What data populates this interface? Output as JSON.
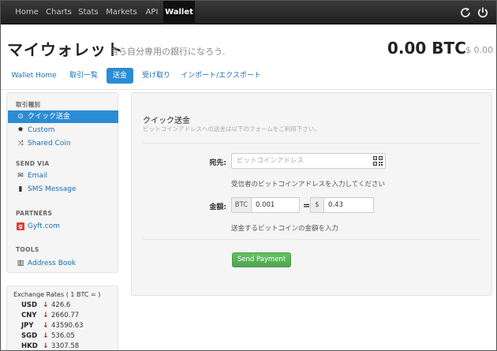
{
  "nav": {
    "items": [
      "Home",
      "Charts",
      "Stats",
      "Markets",
      "API",
      "Wallet"
    ],
    "active": "Wallet",
    "icons": [
      "refresh-icon",
      "power-icon"
    ]
  },
  "header": {
    "title": "マイウォレット",
    "subtitle": "自ら自分専用の銀行になろう.",
    "balance_btc": "0.00 BTC",
    "balance_usd": "$ 0.00"
  },
  "tabs": [
    "Wallet Home",
    "取引一覧",
    "送金",
    "受け取り",
    "インポート/エクスポート"
  ],
  "sidebar": {
    "section_types": "取引種別",
    "types": [
      {
        "icon": "target-icon",
        "label": "クイック送金",
        "active": true
      },
      {
        "icon": "gear-icon",
        "label": "Custom"
      },
      {
        "icon": "shuffle-icon",
        "label": "Shared Coin"
      }
    ],
    "section_send": "SEND VIA",
    "send": [
      {
        "icon": "envelope-icon",
        "label": "Email"
      },
      {
        "icon": "phone-icon",
        "label": "SMS Message"
      }
    ],
    "section_partners": "PARTNERS",
    "partners": [
      {
        "icon": "gyft-icon",
        "icon_text": "g",
        "label": "Gyft.com"
      }
    ],
    "section_tools": "TOOLS",
    "tools": [
      {
        "icon": "book-icon",
        "label": "Address Book"
      }
    ]
  },
  "rates": {
    "title": "Exchange Rates ( 1 BTC = )",
    "down_color": "#b3231a",
    "rows": [
      {
        "code": "USD",
        "value": "426.6"
      },
      {
        "code": "CNY",
        "value": "2660.77"
      },
      {
        "code": "JPY",
        "value": "43590.63"
      },
      {
        "code": "SGD",
        "value": "536.05"
      },
      {
        "code": "HKD",
        "value": "3307.58"
      }
    ]
  },
  "form": {
    "title": "クイック送金",
    "description": "ビットコインアドレスへの送金は以下のフォームをご利用下さい。",
    "to_label": "宛先:",
    "to_placeholder": "ビットコインアドレス",
    "to_help": "受信者のビットコインアドレスを入力してください",
    "amount_label": "金額:",
    "btc_addon": "BTC",
    "btc_value": "0.001",
    "equals": "=",
    "usd_addon": "$",
    "usd_value": "0.43",
    "amount_help": "送金するビットコインの金額を入力",
    "send_button": "Send Payment",
    "button_color": "#5bb75b"
  }
}
